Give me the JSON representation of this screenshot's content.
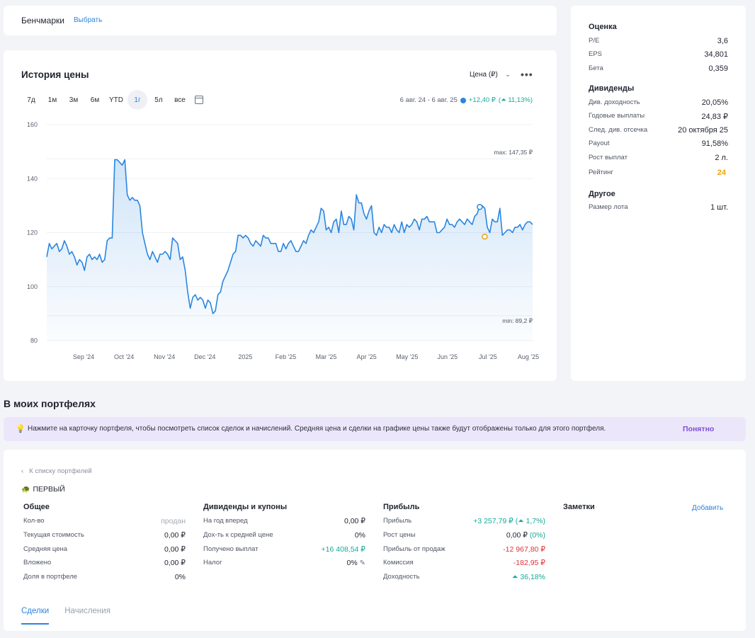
{
  "benchmarks": {
    "title": "Бенчмарки",
    "select": "Выбрать"
  },
  "price_history": {
    "title": "История цены",
    "price_select": "Цена (₽)",
    "periods": [
      "7д",
      "1м",
      "3м",
      "6м",
      "YTD",
      "1г",
      "5л",
      "все"
    ],
    "active_period": "1г",
    "range": "6 авг. 24 - 6 авг. 25",
    "change": "+12,40 ₽",
    "change_pct": "11,13%",
    "max_label": "max: 147,35 ₽",
    "min_label": "min: 89,2 ₽"
  },
  "chart_data": {
    "type": "area",
    "y_ticks": [
      "160",
      "140",
      "120",
      "100",
      "80"
    ],
    "ylim": [
      80,
      160
    ],
    "x_ticks": [
      "Sep '24",
      "Oct '24",
      "Nov '24",
      "Dec '24",
      "2025",
      "Feb '25",
      "Mar '25",
      "Apr '25",
      "May '25",
      "Jun '25",
      "Jul '25",
      "Aug '25"
    ],
    "max": 147.35,
    "min": 89.2,
    "series": [
      {
        "values": [
          111,
          116,
          114,
          115,
          116,
          113,
          114,
          117,
          115,
          112,
          113,
          111,
          108,
          110,
          109,
          106,
          111,
          112,
          110,
          111,
          110,
          112,
          109,
          110,
          117,
          118,
          118,
          147,
          147,
          146,
          145,
          147,
          134,
          132,
          133,
          132,
          132,
          130,
          120,
          116,
          112,
          110,
          113,
          111,
          109,
          112,
          112,
          113,
          112,
          110,
          118,
          117,
          116,
          110,
          111,
          106,
          98,
          92,
          96,
          97,
          95,
          96,
          95,
          92,
          95,
          94,
          90,
          91,
          97,
          98,
          102,
          104,
          106,
          109,
          112,
          113,
          119,
          119,
          118,
          119,
          118,
          116,
          115,
          117,
          116,
          115,
          119,
          118,
          118,
          116,
          116,
          116,
          113,
          113,
          116,
          114,
          116,
          117,
          115,
          113,
          113,
          115,
          117,
          116,
          119,
          121,
          120,
          122,
          124,
          129,
          128,
          121,
          122,
          120,
          124,
          125,
          120,
          128,
          123,
          123,
          126,
          125,
          121,
          134,
          131,
          131,
          127,
          125,
          128,
          130,
          120,
          119,
          122,
          120,
          123,
          122,
          122,
          120,
          123,
          121,
          120,
          124,
          120,
          123,
          122,
          123,
          125,
          124,
          121,
          125,
          125,
          126,
          124,
          124,
          124,
          120,
          120,
          121,
          122,
          125,
          123,
          123,
          122,
          124,
          125,
          124,
          123,
          125,
          124,
          123,
          126,
          127,
          130,
          130,
          129,
          122,
          120,
          125,
          124,
          124,
          129,
          119,
          120,
          121,
          121,
          120,
          122,
          122,
          123,
          121,
          123,
          124,
          124,
          123
        ]
      }
    ],
    "markers": [
      {
        "series_index": 172,
        "value": 129.5,
        "color": "#2a86e0"
      },
      {
        "series_index": 174,
        "value": 118.5,
        "color": "#f0a10c"
      }
    ]
  },
  "metrics": {
    "valuation": {
      "title": "Оценка",
      "rows": [
        {
          "label": "P/E",
          "value": "3,6"
        },
        {
          "label": "EPS",
          "value": "34,801"
        },
        {
          "label": "Бета",
          "value": "0,359"
        }
      ]
    },
    "dividends": {
      "title": "Дивиденды",
      "rows": [
        {
          "label": "Див. доходность",
          "value": "20,05%"
        },
        {
          "label": "Годовые выплаты",
          "value": "24,83 ₽"
        },
        {
          "label": "След. див. отсечка",
          "value": "20 октября 25"
        },
        {
          "label": "Payout",
          "value": "91,58%"
        },
        {
          "label": "Рост выплат",
          "value": "2 л."
        },
        {
          "label": "Рейтинг",
          "value": "24"
        }
      ]
    },
    "other": {
      "title": "Другое",
      "rows": [
        {
          "label": "Размер лота",
          "value": "1 шт."
        }
      ]
    }
  },
  "portfolios": {
    "heading": "В моих портфелях",
    "tip": "Нажмите на карточку портфеля, чтобы посмотреть список сделок и начислений. Средняя цена и сделки на графике цены также будут отображены только для этого портфеля.",
    "tip_ok": "Понятно",
    "back": "К списку портфелей",
    "name": "ПЕРВЫЙ",
    "general": {
      "title": "Общее",
      "rows": [
        {
          "label": "Кол-во",
          "value": "продан"
        },
        {
          "label": "Текущая стоимость",
          "value": "0,00 ₽"
        },
        {
          "label": "Средняя цена",
          "value": "0,00 ₽"
        },
        {
          "label": "Вложено",
          "value": "0,00 ₽"
        },
        {
          "label": "Доля в портфеле",
          "value": "0%"
        }
      ]
    },
    "dividends": {
      "title": "Дивиденды и купоны",
      "rows": [
        {
          "label": "На год вперед",
          "value": "0,00 ₽"
        },
        {
          "label": "Дох-ть к средней цене",
          "value": "0%"
        },
        {
          "label": "Получено выплат",
          "value": "+16 408,54 ₽"
        },
        {
          "label": "Налог",
          "value": "0%"
        }
      ]
    },
    "profit": {
      "title": "Прибыль",
      "rows": [
        {
          "label": "Прибыль",
          "value": "+3 257,79 ₽",
          "extra": "1,7%"
        },
        {
          "label": "Рост цены",
          "value": "0,00 ₽",
          "extra": "0%"
        },
        {
          "label": "Прибыль от продаж",
          "value": "-12 967,80 ₽"
        },
        {
          "label": "Комиссия",
          "value": "-182,95 ₽"
        },
        {
          "label": "Доходность",
          "value": "36,18%"
        }
      ]
    },
    "notes": {
      "title": "Заметки",
      "add": "Добавить"
    },
    "tabs": [
      "Сделки",
      "Начисления"
    ]
  },
  "colors": {
    "accent": "#2a86e0",
    "positive": "#16a89a",
    "negative": "#e0323a",
    "rating": "#f0a10c",
    "tip_bg": "#ece6fb"
  }
}
